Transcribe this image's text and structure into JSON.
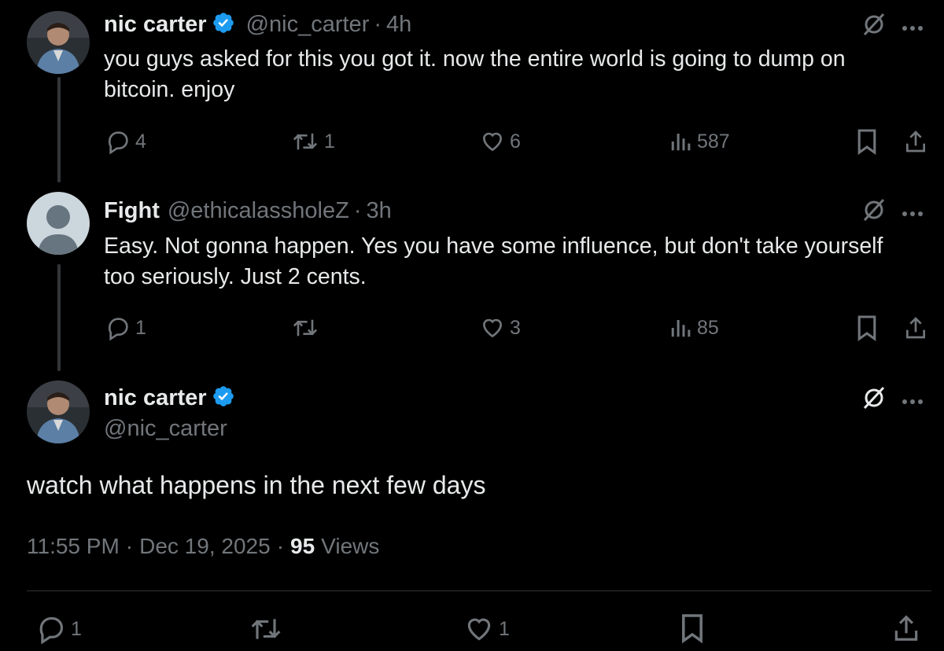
{
  "tweets": [
    {
      "author": "nic carter",
      "handle": "@nic_carter",
      "time": "4h",
      "text_lines": [
        "you guys asked for this you got it. now the entire world is going to dump on",
        "bitcoin. enjoy"
      ],
      "replies": "4",
      "reposts": "1",
      "likes": "6",
      "views": "587"
    },
    {
      "author": "Fight",
      "handle": "@ethicalassholeZ",
      "time": "3h",
      "text_lines": [
        "Easy. Not gonna happen. Yes you have some influence, but don't take yourself",
        "too seriously. Just 2 cents."
      ],
      "replies": "1",
      "reposts": "",
      "likes": "3",
      "views": "85"
    }
  ],
  "main": {
    "author": "nic carter",
    "handle": "@nic_carter",
    "text": "watch what happens in the next few days",
    "time": "11:55 PM",
    "date": "Dec 19, 2025",
    "views_count": "95",
    "views_label": "Views",
    "separator": "·",
    "replies": "1",
    "reposts": "",
    "likes": "1"
  },
  "colors": {
    "background": "#000000",
    "text": "#e7e9ea",
    "muted": "#71767b",
    "verified": "#1d9bf0",
    "divider": "#2f3336"
  },
  "icons": [
    "reply-icon",
    "repost-icon",
    "like-icon",
    "views-icon",
    "bookmark-icon",
    "share-icon",
    "grok-icon",
    "more-icon",
    "verified-badge-icon"
  ]
}
